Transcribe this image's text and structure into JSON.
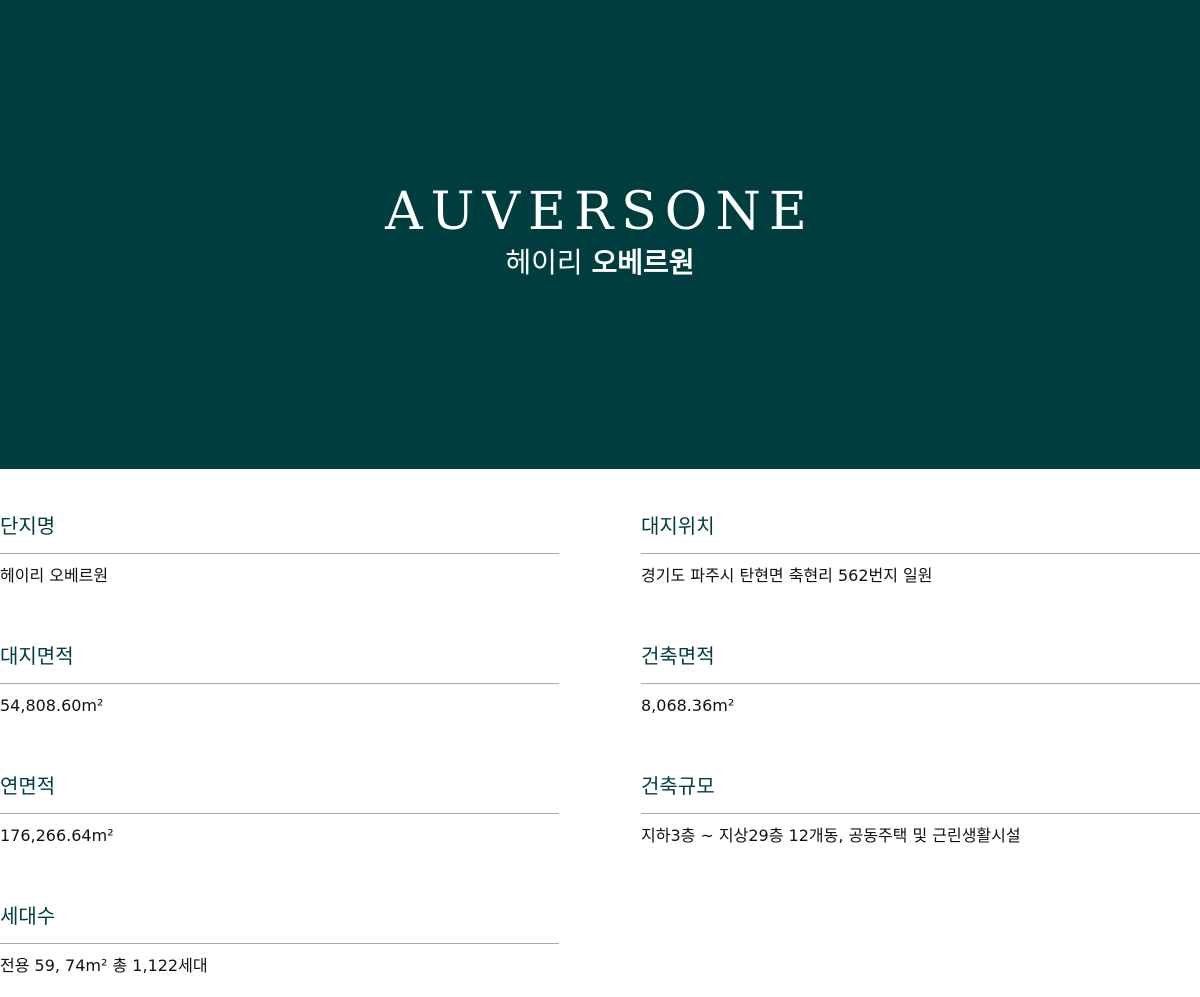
{
  "hero": {
    "brand_en": "AUVERSONE",
    "brand_kr_light": "헤이리",
    "brand_kr_bold": "오베르원"
  },
  "info": {
    "complex_name": {
      "label": "단지명",
      "value": "헤이리 오베르원"
    },
    "site_location": {
      "label": "대지위치",
      "value": "경기도 파주시 탄현면 축현리 562번지 일원"
    },
    "site_area": {
      "label": "대지면적",
      "value": "54,808.60m²"
    },
    "building_area": {
      "label": "건축면적",
      "value": "8,068.36m²"
    },
    "gross_floor_area": {
      "label": "연면적",
      "value": "176,266.64m²"
    },
    "building_scale": {
      "label": "건축규모",
      "value": "지하3층 ~ 지상29층 12개동, 공동주택 및 근린생활시설"
    },
    "households": {
      "label": "세대수",
      "value": "전용 59, 74m² 총 1,122세대"
    }
  },
  "colors": {
    "hero_background": "#003d3e",
    "label_text": "#003d3e",
    "rule": "#a9a9a9"
  }
}
